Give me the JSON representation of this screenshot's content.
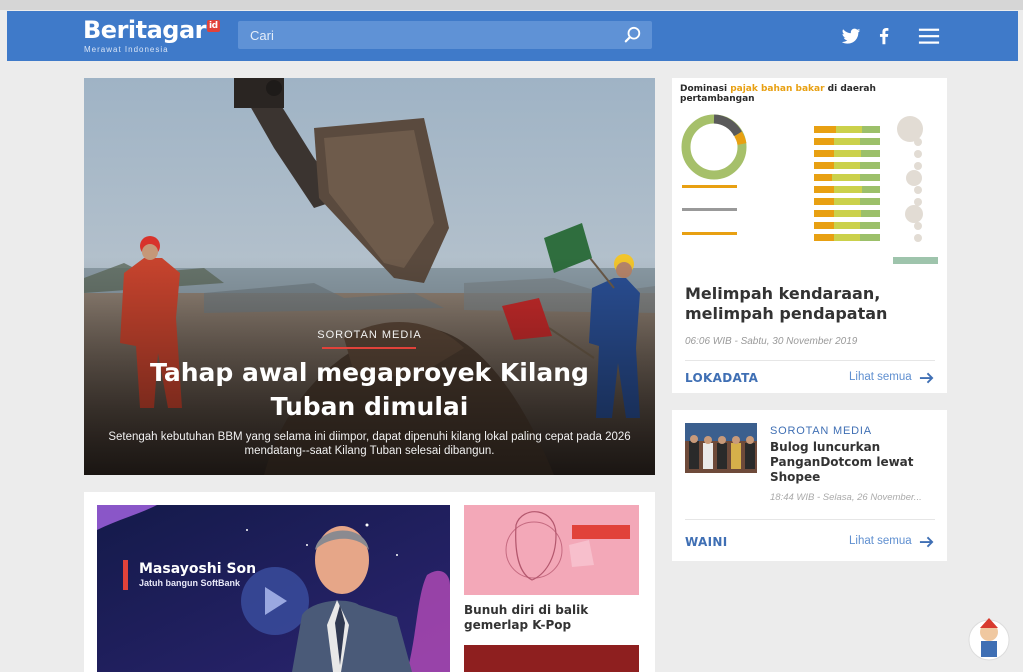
{
  "header": {
    "logo_text": "Beritagar",
    "logo_badge": "id",
    "tagline": "Merawat Indonesia",
    "search_placeholder": "Cari",
    "icons": [
      "search-icon",
      "twitter-icon",
      "facebook-icon",
      "menu-icon"
    ],
    "brand_color": "#3f7ac9"
  },
  "hero": {
    "kicker": "SOROTAN MEDIA",
    "title": "Tahap awal megaproyek Kilang Tuban dimulai",
    "summary": "Setengah kebutuhan BBM yang selama ini diimpor, dapat dipenuhi kilang lokal paling cepat pada 2026 mendatang--saat Kilang Tuban selesai dibangun."
  },
  "lokadata": {
    "infographic": {
      "title_prefix": "Dominasi ",
      "title_highlight": "pajak bahan bakar",
      "title_suffix": " di daerah pertambangan"
    },
    "headline": "Melimpah kendaraan, melimpah pendapatan",
    "time": "06:06 WIB - Sabtu, 30 November 2019",
    "brand": "LOKADATA",
    "more": "Lihat semua"
  },
  "bulog": {
    "kicker": "SOROTAN MEDIA",
    "headline": "Bulog luncurkan PanganDotcom lewat Shopee",
    "time": "18:44 WIB - Selasa, 26 November...",
    "brand": "WAINI",
    "more": "Lihat semua"
  },
  "lower": {
    "video_name": "Masayoshi Son",
    "video_sub": "Jatuh bangun SoftBank",
    "kpop_caption": "Bunuh diri di balik gemerlap K-Pop"
  },
  "colors": {
    "accent_red": "#e1423a",
    "link_blue": "#3f6fb4"
  }
}
